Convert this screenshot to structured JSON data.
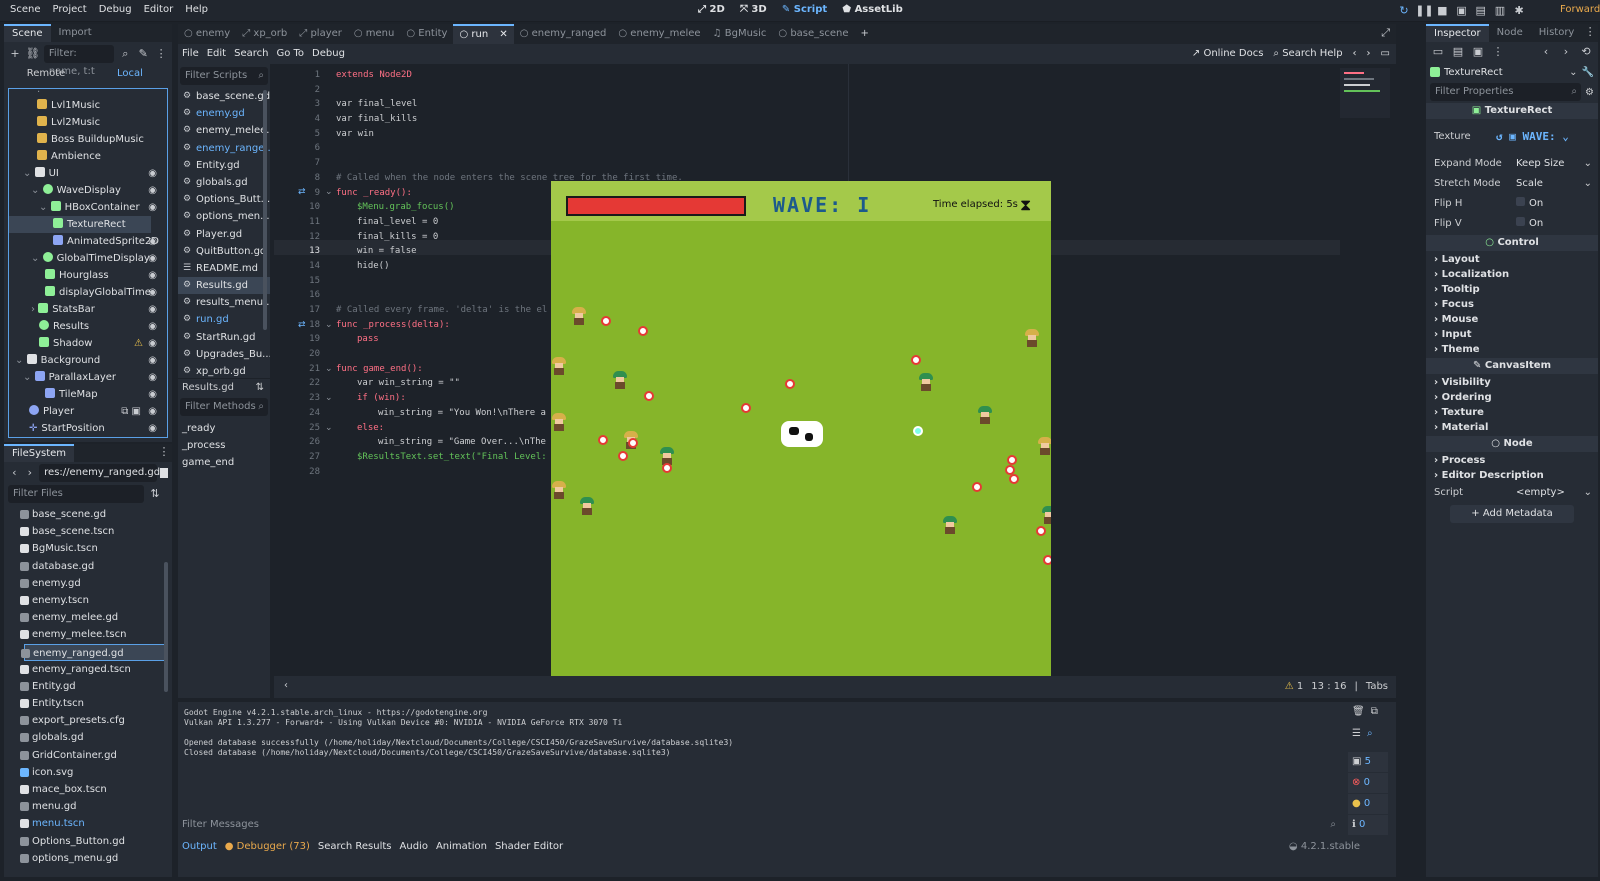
{
  "menu": [
    "Scene",
    "Project",
    "Debug",
    "Editor",
    "Help"
  ],
  "main_screens": [
    "2D",
    "3D",
    "Script",
    "AssetLib"
  ],
  "renderer": "Forward+",
  "scene_dock": {
    "tabs": [
      "Scene",
      "Import"
    ],
    "filter_placeholder": "Filter: name, t:t",
    "remote": "Remote",
    "local": "Local",
    "nodes": [
      "Lvl1Music",
      "Lvl2Music",
      "Boss BuildupMusic",
      "Ambience",
      "UI",
      "WaveDisplay",
      "HBoxContainer",
      "TextureRect",
      "AnimatedSprite2D",
      "GlobalTimeDisplay",
      "Hourglass",
      "displayGlobalTime",
      "StatsBar",
      "Results",
      "Shadow",
      "Background",
      "ParallaxLayer",
      "TileMap",
      "Player",
      "StartPosition"
    ]
  },
  "filesystem": {
    "title": "FileSystem",
    "path": "res://enemy_ranged.gd",
    "filter_placeholder": "Filter Files",
    "files": [
      "base_scene.gd",
      "base_scene.tscn",
      "BgMusic.tscn",
      "database.gd",
      "enemy.gd",
      "enemy.tscn",
      "enemy_melee.gd",
      "enemy_melee.tscn",
      "enemy_ranged.gd",
      "enemy_ranged.tscn",
      "Entity.gd",
      "Entity.tscn",
      "export_presets.cfg",
      "globals.gd",
      "GridContainer.gd",
      "icon.svg",
      "mace_box.tscn",
      "menu.gd",
      "menu.tscn",
      "Options_Button.gd",
      "options_menu.gd"
    ]
  },
  "editor_tabs": [
    "enemy",
    "xp_orb",
    "player",
    "menu",
    "Entity",
    "run",
    "enemy_ranged",
    "enemy_melee",
    "BgMusic",
    "base_scene"
  ],
  "script_menu": [
    "File",
    "Edit",
    "Search",
    "Go To",
    "Debug"
  ],
  "online_docs": "Online Docs",
  "search_help": "Search Help",
  "scripts_panel": {
    "filter_placeholder": "Filter Scripts",
    "scripts": [
      "base_scene.gd",
      "enemy.gd",
      "enemy_melee...",
      "enemy_range...",
      "Entity.gd",
      "globals.gd",
      "Options_Butt...",
      "options_men...",
      "Player.gd",
      "QuitButton.gd",
      "README.md",
      "Results.gd",
      "results_menu...",
      "run.gd",
      "StartRun.gd",
      "Upgrades_Bu...",
      "xp_orb.gd"
    ],
    "current": "Results.gd",
    "methods_placeholder": "Filter Methods",
    "methods": [
      "_ready",
      "_process",
      "game_end"
    ]
  },
  "code": {
    "line_numbers": [
      "1",
      "2",
      "3",
      "4",
      "5",
      "6",
      "7",
      "8",
      "9",
      "10",
      "11",
      "12",
      "13",
      "14",
      "15",
      "16",
      "17",
      "18",
      "19",
      "20",
      "21",
      "22",
      "23",
      "24",
      "25",
      "26",
      "27",
      "28"
    ],
    "l1": "extends Node2D",
    "l3": "var final_level",
    "l4": "var final_kills",
    "l5": "var win",
    "l8": "# Called when the node enters the scene tree for the first time.",
    "l9": "func _ready():",
    "l10": "$Menu.grab_focus()",
    "l11": "final_level = 0",
    "l12": "final_kills = 0",
    "l13": "win = false",
    "l14": "hide()",
    "l17": "# Called every frame. 'delta' is the el",
    "l18": "func _process(delta):",
    "l19": "pass",
    "l21": "func game_end():",
    "l22": "var win_string = \"\"",
    "l23": "if (win):",
    "l24": "win_string = \"You Won!\\nThere a",
    "l25": "else:",
    "l26": "win_string = \"Game Over...\\nThe",
    "l27": "$ResultsText.set_text(\"Final Level:"
  },
  "status": {
    "warnings": "1",
    "line": "13",
    "col": "16",
    "indent": "Tabs"
  },
  "game": {
    "wave_label": "WAVE: I",
    "time_label": "Time elapsed: 5s",
    "health": 1.0
  },
  "output": {
    "lines": [
      "Godot Engine v4.2.1.stable.arch_linux - https://godotengine.org",
      "Vulkan API 1.3.277 - Forward+ - Using Vulkan Device #0: NVIDIA - NVIDIA GeForce RTX 3070 Ti",
      "",
      "Opened database successfully (/home/holiday/Nextcloud/Documents/College/CSCI450/GrazeSaveSurvive/database.sqlite3)",
      "Closed database (/home/holiday/Nextcloud/Documents/College/CSCI450/GrazeSaveSurvive/database.sqlite3)"
    ],
    "filter_placeholder": "Filter Messages",
    "counts": [
      "5",
      "0",
      "0",
      "0"
    ],
    "bottom_tabs": [
      "Output",
      "Debugger (73)",
      "Search Results",
      "Audio",
      "Animation",
      "Shader Editor"
    ],
    "version": "4.2.1.stable"
  },
  "inspector": {
    "tabs": [
      "Inspector",
      "Node",
      "History"
    ],
    "node_name": "TextureRect",
    "filter_placeholder": "Filter Properties",
    "class_header": "TextureRect",
    "texture_label": "Texture",
    "texture_value": "WAVE:",
    "props": [
      {
        "name": "Expand Mode",
        "value": "Keep Size"
      },
      {
        "name": "Stretch Mode",
        "value": "Scale"
      },
      {
        "name": "Flip H",
        "value": "On"
      },
      {
        "name": "Flip V",
        "value": "On"
      }
    ],
    "control_header": "Control",
    "control_sections": [
      "Layout",
      "Localization",
      "Tooltip",
      "Focus",
      "Mouse",
      "Input",
      "Theme"
    ],
    "canvas_header": "CanvasItem",
    "canvas_sections": [
      "Visibility",
      "Ordering",
      "Texture",
      "Material"
    ],
    "node_header": "Node",
    "node_sections": [
      "Process",
      "Editor Description"
    ],
    "script_label": "Script",
    "script_value": "<empty>",
    "add_metadata": "Add Metadata"
  },
  "colors": {
    "accent": "#6cb6ff",
    "grass": "#86b52a",
    "health": "#e53935"
  }
}
